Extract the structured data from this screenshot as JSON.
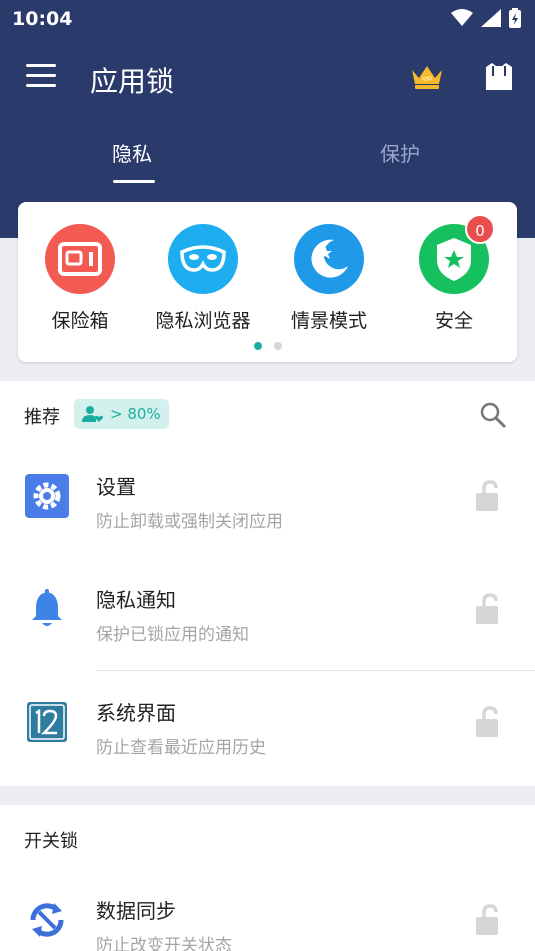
{
  "status_bar": {
    "time": "10:04"
  },
  "app_bar": {
    "title": "应用锁"
  },
  "tabs": [
    {
      "label": "隐私",
      "active": true
    },
    {
      "label": "保护",
      "active": false
    }
  ],
  "features": [
    {
      "label": "保险箱",
      "icon": "safe-box-icon",
      "color": "#f25a52"
    },
    {
      "label": "隐私浏览器",
      "icon": "mask-icon",
      "color": "#1eaef0"
    },
    {
      "label": "情景模式",
      "icon": "moon-star-icon",
      "color": "#1e9ae8"
    },
    {
      "label": "安全",
      "icon": "shield-star-icon",
      "color": "#17c05e",
      "badge": "0"
    }
  ],
  "carousel": {
    "pages": 2,
    "current": 1
  },
  "recommend": {
    "title": "推荐",
    "pill_text": "> 80%",
    "items": [
      {
        "title": "设置",
        "subtitle": "防止卸载或强制关闭应用",
        "icon": "settings-gear-icon"
      },
      {
        "title": "隐私通知",
        "subtitle": "保护已锁应用的通知",
        "icon": "bell-icon"
      },
      {
        "title": "系统界面",
        "subtitle": "防止查看最近应用历史",
        "icon": "recent-apps-icon"
      }
    ]
  },
  "switch_lock": {
    "title": "开关锁",
    "items": [
      {
        "title": "数据同步",
        "subtitle": "防止改变开关状态",
        "icon": "sync-icon"
      }
    ]
  },
  "colors": {
    "header": "#293a6b",
    "accent": "#1aaea0",
    "lock": "#d6d6d6"
  }
}
